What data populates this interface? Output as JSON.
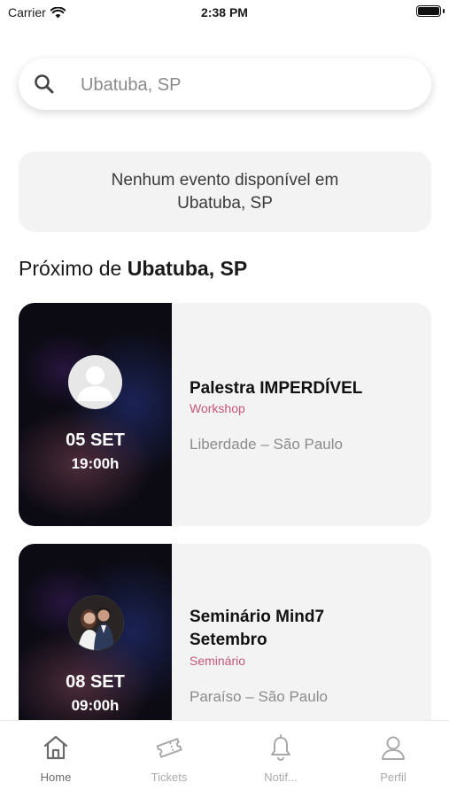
{
  "status_bar": {
    "carrier": "Carrier",
    "time": "2:38 PM"
  },
  "search": {
    "value": "Ubatuba, SP",
    "placeholder": ""
  },
  "notice": {
    "line1": "Nenhum evento disponível em",
    "line2": "Ubatuba, SP"
  },
  "section": {
    "prefix": "Próximo de ",
    "location": "Ubatuba, SP"
  },
  "events": [
    {
      "date": "05 SET",
      "time": "19:00h",
      "title_line1": "Palestra IMPERDÍVEL",
      "title_line2": "",
      "category": "Workshop",
      "location": "Liberdade – São Paulo",
      "avatar": "default-user-avatar"
    },
    {
      "date": "08 SET",
      "time": "09:00h",
      "title_line1": "Seminário Mind7",
      "title_line2": "Setembro",
      "category": "Seminário",
      "location": "Paraíso – São Paulo",
      "avatar": "couple-photo-avatar"
    }
  ],
  "tabs": [
    {
      "label": "Home",
      "icon": "home-icon",
      "active": true
    },
    {
      "label": "Tickets",
      "icon": "ticket-icon",
      "active": false
    },
    {
      "label": "Notif...",
      "icon": "bell-icon",
      "active": false
    },
    {
      "label": "Perfil",
      "icon": "person-icon",
      "active": false
    }
  ],
  "colors": {
    "accent": "#c4577a",
    "card_bg": "#f3f3f3",
    "tab_active": "#6b6b6b",
    "tab_inactive": "#a9a9a9"
  }
}
